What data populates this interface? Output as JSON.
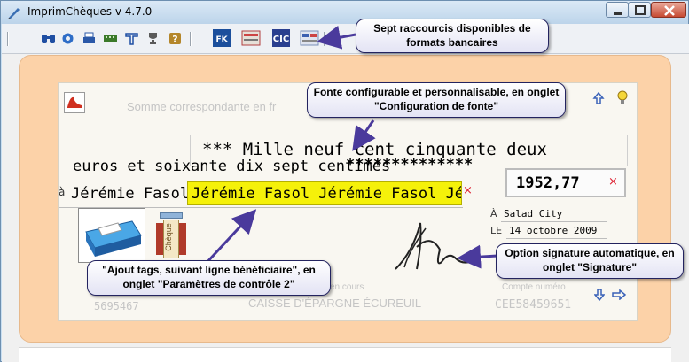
{
  "window": {
    "title": "ImprimChèques  v 4.7.0"
  },
  "toolbar": {
    "icons": [
      "binoculars-icon",
      "gear-icon",
      "printer-icon",
      "keyboard-icon",
      "font-icon",
      "trophy-icon",
      "help-icon"
    ],
    "format_icons": [
      "format-1-icon",
      "format-2-icon",
      "format-3-icon",
      "format-4-icon"
    ]
  },
  "cheque": {
    "amount_hint": "Somme correspondante en fr",
    "amount_line1": "*** Mille neuf cent cinquante deux",
    "amount_line2": "euros et soixante dix sept centimes",
    "amount_stars": "**************",
    "payee_prefix": "à",
    "payee_name": "Jérémie Fasol",
    "payee_tags": "Jérémie Fasol Jérémie Fasol Jéré",
    "clear_mark": "×",
    "amount_value": "1952,77",
    "place_prefix": "À",
    "place": "Salad City",
    "date_prefix": "LE",
    "date": "14 octobre 2009",
    "account_hint_left": "en cours",
    "account_hint_right": "Compte numéro",
    "account_number": "CEE58459651",
    "code_left": "5695467",
    "bank_name": "CAISSE D'ÉPARGNE ÉCUREUIL",
    "cheque_button_label": "Chèque"
  },
  "callouts": {
    "shortcuts": "Sept raccourcis disponibles de formats bancaires",
    "font": "Fonte configurable et personnalisable, en onglet \"Configuration de fonte\"",
    "tags": "\"Ajout tags, suivant ligne bénéficiaire\", en onglet \"Paramètres de contrôle 2\"",
    "signature": "Option signature automatique, en onglet \"Signature\""
  },
  "colors": {
    "accent": "#23235f",
    "frame": "#fcd2a8",
    "highlight": "#f5f10a"
  }
}
